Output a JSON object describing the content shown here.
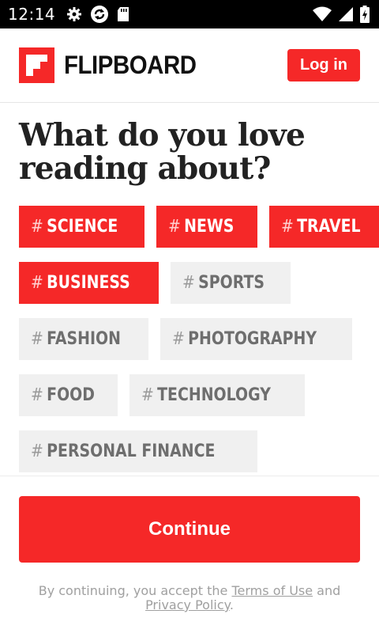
{
  "status_bar": {
    "time": "12:14",
    "icons_left": [
      "gear-icon",
      "sync-icon",
      "sd-card-icon"
    ],
    "icons_right": [
      "wifi-icon",
      "signal-icon",
      "battery-icon"
    ]
  },
  "header": {
    "brand": "FLIPBOARD",
    "login_label": "Log in"
  },
  "main": {
    "title": "What do you love reading about?",
    "topic_hash": "#",
    "topics": [
      {
        "label": "SCIENCE",
        "selected": true
      },
      {
        "label": "NEWS",
        "selected": true
      },
      {
        "label": "TRAVEL",
        "selected": true
      },
      {
        "label": "BUSINESS",
        "selected": true
      },
      {
        "label": "SPORTS",
        "selected": false
      },
      {
        "label": "FASHION",
        "selected": false
      },
      {
        "label": "PHOTOGRAPHY",
        "selected": false
      },
      {
        "label": "FOOD",
        "selected": false
      },
      {
        "label": "TECHNOLOGY",
        "selected": false
      },
      {
        "label": "PERSONAL FINANCE",
        "selected": false
      }
    ]
  },
  "footer": {
    "continue_label": "Continue",
    "legal_prefix": "By continuing, you accept the ",
    "terms_link": "Terms of Use",
    "legal_and": " and ",
    "privacy_link": "Privacy Policy",
    "legal_suffix": "."
  },
  "colors": {
    "brand_red": "#f52828",
    "chip_grey": "#f0f0f0",
    "chip_text_grey": "#6e6e6e"
  }
}
